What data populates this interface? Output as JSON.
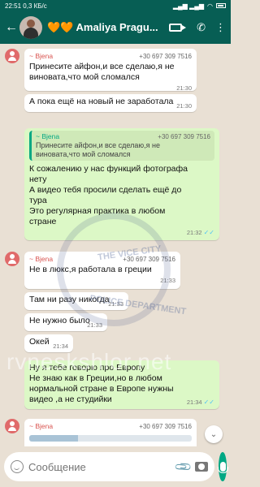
{
  "status": {
    "time": "22:51",
    "speed": "0,3 КБ/с",
    "signal": "ull ull",
    "battery": "batt"
  },
  "header": {
    "title": "🧡🧡 Amaliya Pragu...",
    "back_icon": "arrow-left",
    "video_icon": "video-camera",
    "call_icon": "phone",
    "menu_icon": "more-vertical"
  },
  "messages": [
    {
      "sender": "~ Bjena",
      "phone": "+30 697 309 7516",
      "text": "Принесите айфон,и все сделаю,я не\nвиновата,что мой сломался",
      "time": "21:30"
    },
    {
      "text": "А пока ещё на новый не заработала",
      "time": "21:30"
    },
    {
      "quote_sender": "~ Bjena",
      "quote_phone": "+30 697 309 7516",
      "quote_text": "Принесите айфон,и все сделаю,я не\nвиноватa,что мой сломался",
      "text": "К сожалению у нас функций фотографа\nнету\nА видео тебя просили сделать ещё до\nтура\nЭто регулярная практика в любом\nстране",
      "time": "21:32",
      "ticks": "✓✓"
    },
    {
      "sender": "~ Bjena",
      "phone": "+30 697 309 7516",
      "text": "Не в люкс,я работала в греции",
      "time": "21:33"
    },
    {
      "text": "Там ни разу никогда",
      "time": "21:33"
    },
    {
      "text": "Не нужно было",
      "time": "21:33"
    },
    {
      "text": "Окей",
      "time": "21:34"
    },
    {
      "text": "Ну я тебе говорю про Европу\nНе знаю как в Греции,но в любом\nнормальной стране в Европе нужны\nвидео ,а не студийки",
      "time": "21:34",
      "ticks": "✓✓"
    },
    {
      "sender": "~ Bjena",
      "phone": "+30 697 309 7516"
    }
  ],
  "watermark": {
    "seal_top": "THE VICE CITY",
    "seal_bottom": "POLICE DEPARTMENT",
    "text": "rvneskshlor.net"
  },
  "input": {
    "placeholder": "Сообщение"
  }
}
